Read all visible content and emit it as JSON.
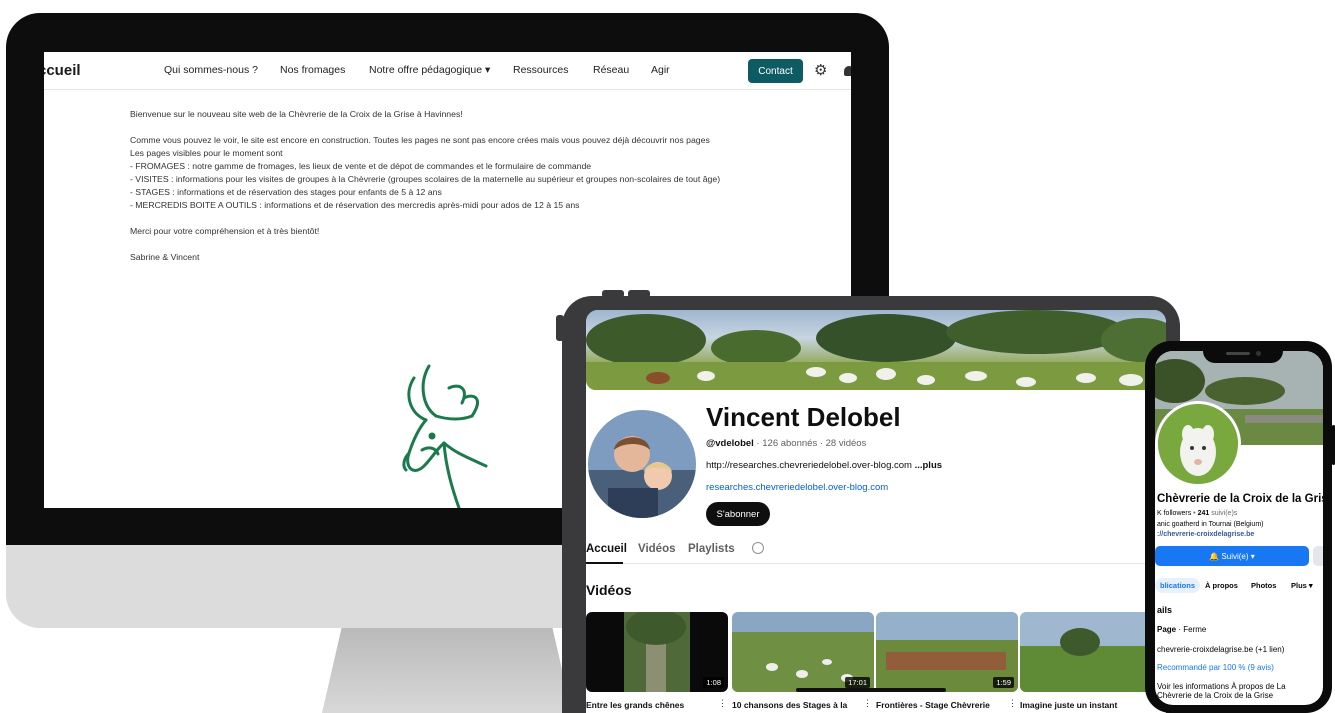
{
  "desktop": {
    "logo": "ccueil",
    "nav": [
      "Qui sommes-nous ?",
      "Nos fromages",
      "Notre offre pédagogique ▾",
      "Ressources",
      "Réseau",
      "Agir"
    ],
    "contact_label": "Contact",
    "body": [
      "Bienvenue sur le nouveau site web de la Chèvrerie de la Croix de la Grise à Havinnes!",
      "",
      "Comme vous pouvez le voir, le site est encore en construction. Toutes les pages ne sont pas encore crées mais vous pouvez déjà découvrir nos pages",
      "Les pages visibles pour le moment sont",
      "- FROMAGES : notre gamme de fromages, les lieux de vente et de dépot de commandes et le formulaire de commande",
      "- VISITES : informations pour les visites de groupes à la Chèvrerie (groupes scolaires de la maternelle au supérieur et groupes non-scolaires de tout âge)",
      "- STAGES : informations et de réservation des stages pour enfants de 5 à 12 ans",
      "- MERCREDIS BOITE A OUTILS : informations et de réservation des mercredis après-midi pour ados de 12 à 15 ans",
      "",
      "Merci pour votre compréhension et à très bientôt!",
      "",
      "Sabrine & Vincent"
    ]
  },
  "youtube": {
    "channel_name": "Vincent Delobel",
    "handle": "@vdelobel",
    "stats": " · 126 abonnés · 28 vidéos",
    "description": "http://researches.chevreriedelobel.over-blog.com ",
    "more": "...plus",
    "link": "researches.chevreriedelobel.over-blog.com",
    "subscribe_label": "S'abonner",
    "tabs": [
      "Accueil",
      "Vidéos",
      "Playlists"
    ],
    "section_title": "Vidéos",
    "videos": [
      {
        "title": "Entre les grands chênes",
        "duration": "1:08"
      },
      {
        "title": "10 chansons des Stages à la",
        "duration": "17:01"
      },
      {
        "title": "Frontières - Stage Chèvrerie",
        "duration": "1:59"
      },
      {
        "title": "Imagine juste un instant",
        "duration": ""
      }
    ]
  },
  "facebook": {
    "page_name": "Chèvrerie de la Croix de la Grise",
    "followers": "K followers",
    "following_count": "241",
    "following_label": " suivi(e)s",
    "bio": "anic goatherd in Tournai (Belgium)",
    "website": "://chevrerie-croixdelagrise.be",
    "follow_label": "Suivi(e) ▾",
    "tabs": [
      "blications",
      "À propos",
      "Photos",
      "Plus ▾"
    ],
    "details_heading": "ails",
    "page_type_bold": "Page",
    "page_type": " · Ferme",
    "site_row": "chevrerie-croixdelagrise.be (+1 lien)",
    "recommend": "Recommandé par 100 % (9 avis)",
    "about_link": "Voir les informations À propos de La Chèvrerie de la Croix de la Grise"
  },
  "colors": {
    "contact_bg": "#0e5c63",
    "goat_green": "#1a7a4c",
    "fb_blue": "#1877f2",
    "yt_link": "#065fd4"
  }
}
